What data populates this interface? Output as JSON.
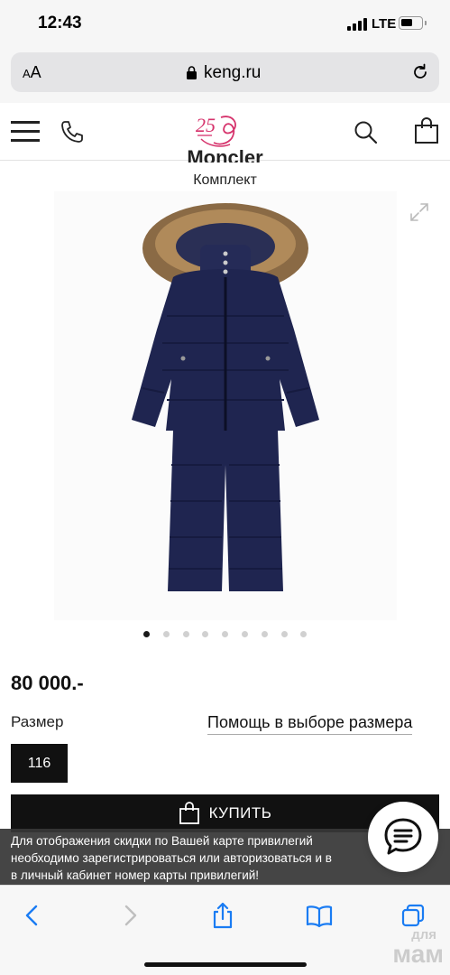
{
  "status_bar": {
    "time": "12:43",
    "network": "LTE"
  },
  "browser": {
    "text_size_label": "AA",
    "url": "keng.ru"
  },
  "product": {
    "brand": "Moncler",
    "type": "Комплект",
    "price": "80 000.-",
    "size_label": "Размер",
    "size_help": "Помощь в выборе размера",
    "selected_size": "116",
    "buy_label": "КУПИТЬ",
    "image_count": 9,
    "active_image": 1
  },
  "banner": {
    "text_line1": "Для отображения скидки по Вашей карте привилегий",
    "text_line2": "необходимо зарегистрироваться или авторизоваться и в",
    "text_line3": "в личный кабинет номер карты привилегий!"
  },
  "colors": {
    "accent": "#d6336c",
    "dark": "#111111",
    "toolbar_blue": "#1a7cf3",
    "jacket": "#1f2550"
  },
  "watermark": {
    "top": "для",
    "bottom": "мам"
  }
}
